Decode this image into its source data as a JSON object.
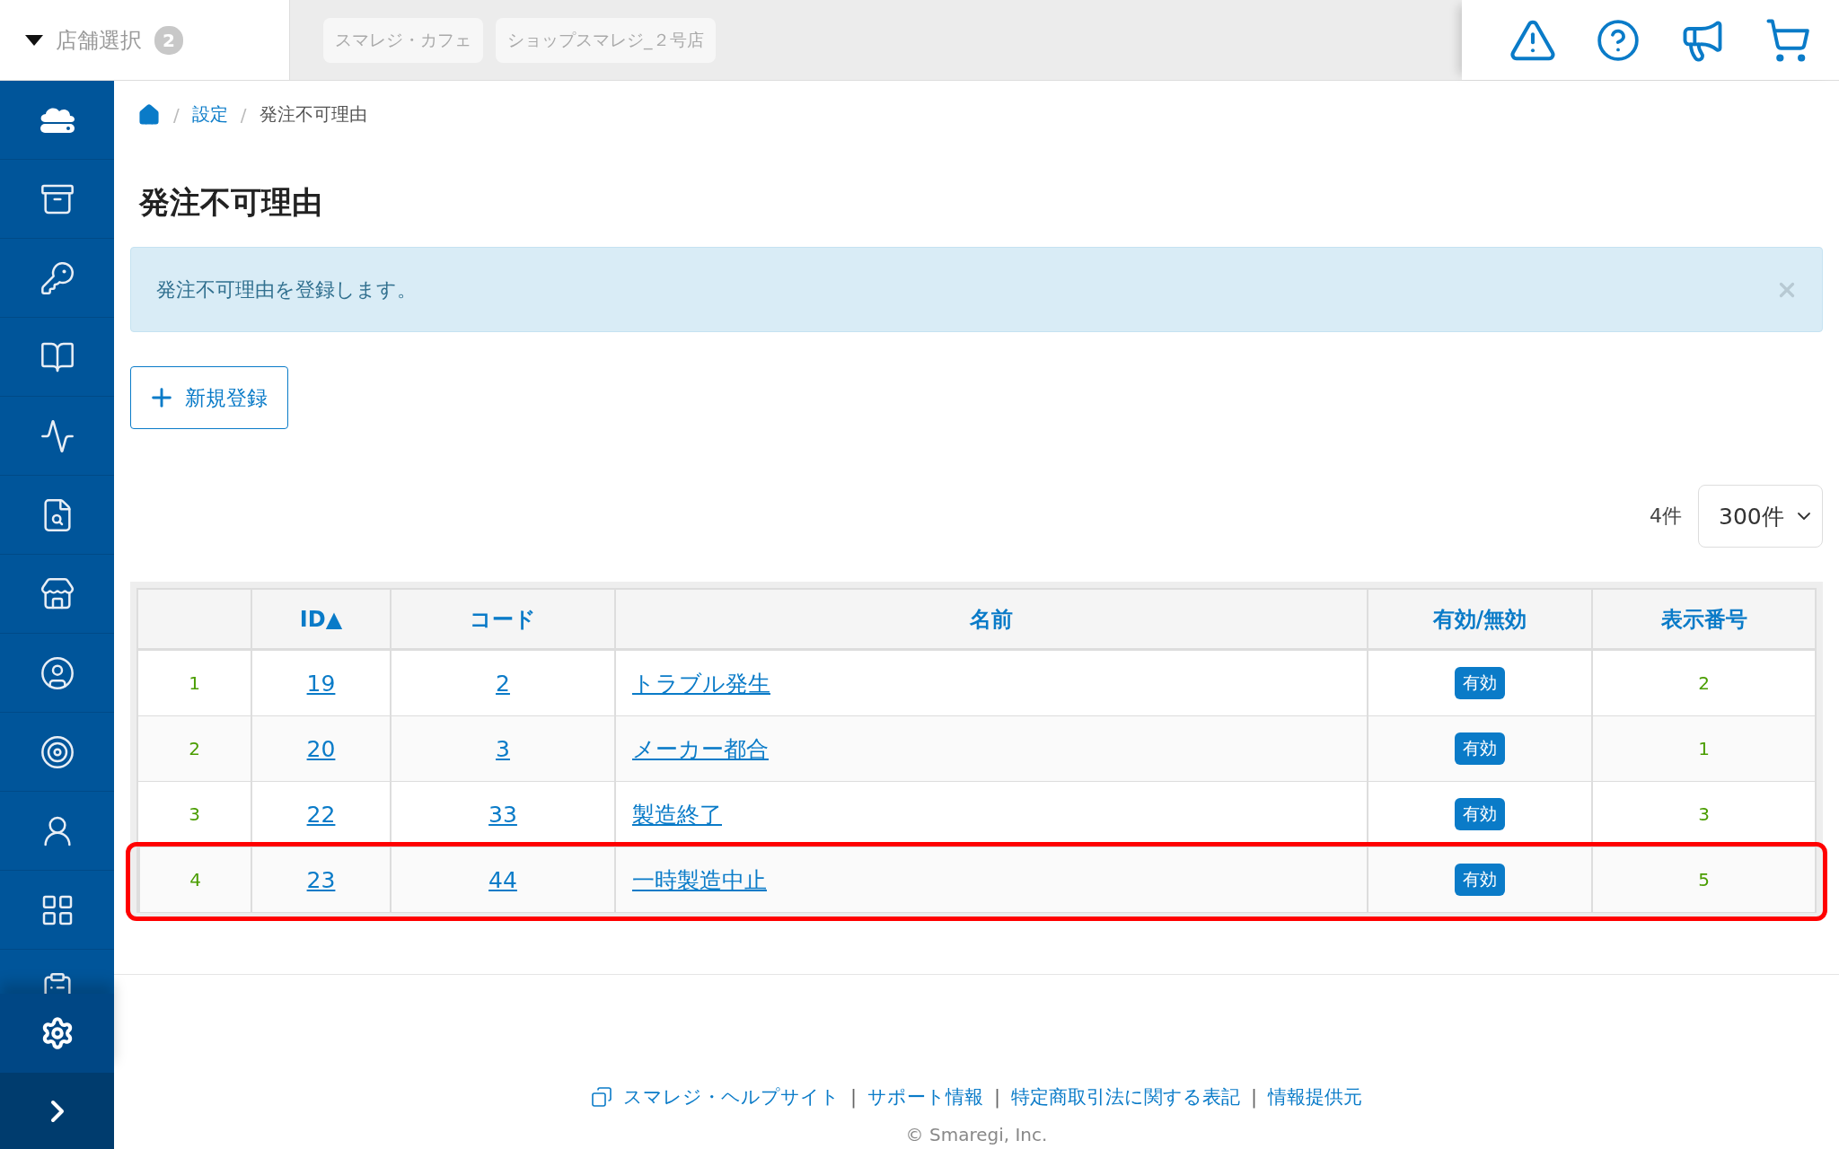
{
  "store_selector": {
    "label": "店舗選択",
    "count": "2"
  },
  "store_tabs": [
    "スマレジ・カフェ",
    "ショップスマレジ_２号店"
  ],
  "sidebar": {
    "items": [
      {
        "selected": false
      },
      {
        "selected": false
      },
      {
        "selected": false
      },
      {
        "selected": false
      },
      {
        "selected": false
      },
      {
        "selected": false
      },
      {
        "selected": false
      },
      {
        "selected": false
      },
      {
        "selected": false
      },
      {
        "selected": false
      },
      {
        "selected": false
      },
      {
        "selected": false
      }
    ],
    "settings": {
      "selected": true
    }
  },
  "breadcrumb": [
    {
      "kind": "home"
    },
    {
      "kind": "link",
      "label": "設定"
    },
    {
      "kind": "current",
      "label": "発注不可理由"
    }
  ],
  "breadcrumb_separators": [
    "/",
    "/"
  ],
  "page_title": "発注不可理由",
  "alert": {
    "message": "発注不可理由を登録します。"
  },
  "new_button": {
    "label": "新規登録"
  },
  "result_count": "4件",
  "page_size": {
    "value": "300件"
  },
  "table": {
    "columns": [
      {},
      {
        "label": "ID▲"
      },
      {
        "label": "コード"
      },
      {
        "label": "名前"
      },
      {
        "label": "有効/無効"
      },
      {
        "label": "表示番号"
      }
    ],
    "rows": [
      {
        "no": "1",
        "id": "19",
        "code": "2",
        "name": "トラブル発生",
        "status": "有効",
        "order": "2",
        "highlighted": false
      },
      {
        "no": "2",
        "id": "20",
        "code": "3",
        "name": "メーカー都合",
        "status": "有効",
        "order": "1",
        "highlighted": false
      },
      {
        "no": "3",
        "id": "22",
        "code": "33",
        "name": "製造終了",
        "status": "有効",
        "order": "3",
        "highlighted": false
      },
      {
        "no": "4",
        "id": "23",
        "code": "44",
        "name": "一時製造中止",
        "status": "有効",
        "order": "5",
        "highlighted": true
      }
    ]
  },
  "footer": {
    "items": [
      {
        "kind": "link",
        "label": "スマレジ・ヘルプサイト",
        "external": true
      },
      {
        "kind": "separator",
        "label": "|"
      },
      {
        "kind": "link",
        "label": "サポート情報"
      },
      {
        "kind": "separator",
        "label": "|"
      },
      {
        "kind": "link",
        "label": "特定商取引法に関する表記"
      },
      {
        "kind": "separator",
        "label": "|"
      },
      {
        "kind": "link",
        "label": "情報提供元"
      }
    ],
    "copyright": "© Smaregi, Inc."
  }
}
